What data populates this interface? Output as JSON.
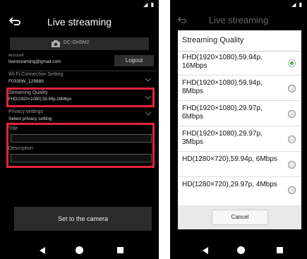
{
  "left": {
    "title": "Live streaming",
    "camera_name": "DC-GH5M2",
    "account_label": "Account",
    "account_value": "livestreaming@gmail.com",
    "logout_label": "Logout",
    "wifi_label": "Wi-Fi Connection Setting",
    "wifi_value": "F0330W_129888",
    "quality_label": "Streaming Quality",
    "quality_value": "FHD(1920×1080),59.94p,16Mbps",
    "privacy_label": "Privacy settings",
    "privacy_value": "Select privacy setting",
    "title_field_label": "Title",
    "description_field_label": "Description",
    "set_button_label": "Set to the camera"
  },
  "right": {
    "background_title": "Live streaming",
    "dialog_title": "Streaming Quality",
    "options": [
      {
        "label": "FHD(1920×1080),59.94p, 16Mbps",
        "selected": true
      },
      {
        "label": "FHD(1920×1080),59.94p, 8Mbps",
        "selected": false
      },
      {
        "label": "FHD(1920×1080),29.97p, 6Mbps",
        "selected": false
      },
      {
        "label": "FHD(1920×1080),29.97p, 3Mbps",
        "selected": false
      },
      {
        "label": "HD(1280×720),59.94p, 6Mbps",
        "selected": false
      },
      {
        "label": "HD(1280×720),29.97p, 4Mbps",
        "selected": false
      }
    ],
    "cancel_label": "Cancel"
  },
  "colors": {
    "highlight": "#e5233b",
    "radio_selected": "#35c22a",
    "screen_bg": "#000000"
  },
  "icons": [
    "back-arrow-icon",
    "camera-icon",
    "chevron-down-icon",
    "nav-back-icon",
    "nav-home-icon",
    "nav-recents-icon",
    "signal-icon",
    "battery-icon"
  ]
}
